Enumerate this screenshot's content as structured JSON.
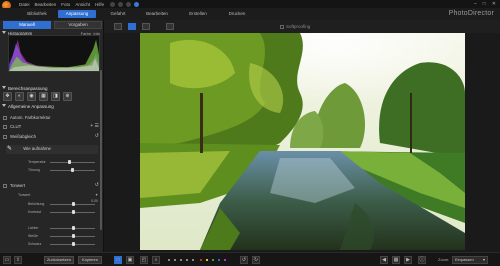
{
  "menubar": {
    "items": [
      "Datei",
      "Bearbeiten",
      "Foto",
      "Ansicht",
      "Hilfe"
    ]
  },
  "window_controls": [
    "–",
    "□",
    "✕"
  ],
  "nav": {
    "left_tabs": [
      "Bibliothek",
      "Anpassung"
    ],
    "right_tabs": [
      "Gefahrt",
      "Bearbeiten",
      "Erstellen",
      "Drucken"
    ],
    "brand": "PhotoDirector"
  },
  "panel": {
    "mode_buttons": [
      "Manuell",
      "Vorgaben"
    ],
    "histogram": {
      "title": "Histogramm",
      "right_a": "Farbe",
      "right_b": "Info"
    },
    "region": {
      "title": "Bereichsanpassung"
    },
    "tools": [
      "✥",
      "◐",
      "◉",
      "▦",
      "◨",
      "⊕"
    ],
    "general": {
      "title": "Allgemeine Anpassung"
    },
    "auto_color": "Autom. Farbkorrektur",
    "clut": "CLUT",
    "white_balance": "Weißabgleich",
    "as_shot": "Wie aufnahme",
    "temperature": "Temperatur",
    "tint": "Tönung",
    "tone": "Tonwert",
    "tone_sub": "Tonwert",
    "exposure": "Belichtung",
    "exposure_value": "0.00",
    "contrast": "Kontrast",
    "highlights": "Lichter",
    "whites": "Weiße",
    "blacks": "Schwarz"
  },
  "photo_toolbar": {
    "softproof": "Softproofing"
  },
  "bottombar": {
    "buttons": [
      "Zurücksetzen",
      "Kopieren"
    ],
    "zoom_label": "Zoom:",
    "zoom_value": "Einpassen"
  },
  "colors": {
    "accent": "#2f6fd1",
    "panel_bg": "#262626",
    "app_bg": "#1a1a1a"
  }
}
